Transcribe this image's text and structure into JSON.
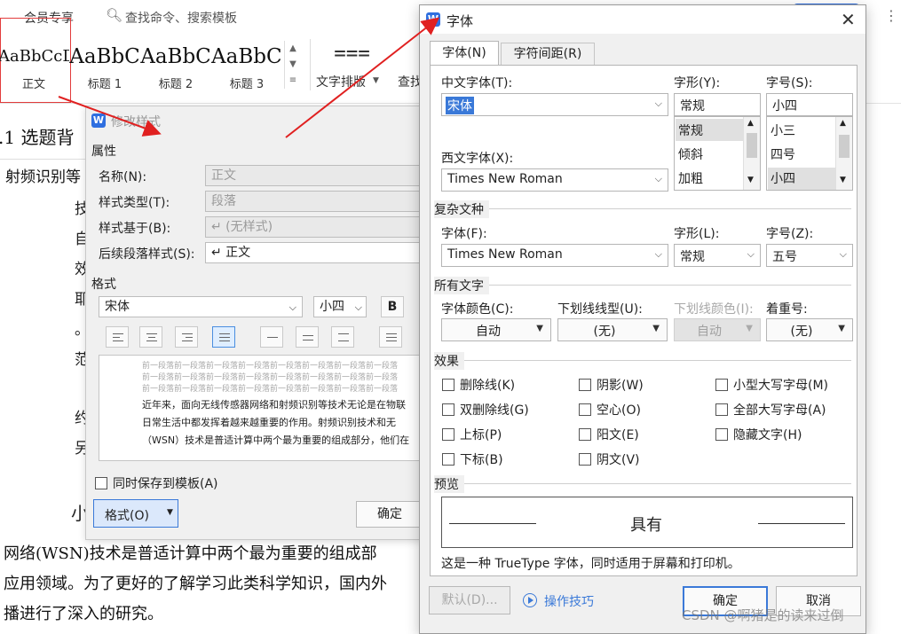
{
  "app": {
    "tabs": {
      "member": "会员专享",
      "search": "查找命令、搜索模板"
    },
    "styles": [
      {
        "preview": "AaBbCcDd",
        "label": "正文"
      },
      {
        "preview": "AaBbC",
        "label": "标题 1"
      },
      {
        "preview": "AaBbC",
        "label": "标题 2"
      },
      {
        "preview": "AaBbCc",
        "label": "标题 3"
      }
    ],
    "text_layout_label": "文字排版",
    "find_label": "查找",
    "doc": {
      "heading": ".1 选题背",
      "line2": "射频识别等",
      "body_lines": [
        "网络(WSN)技术是普适计算中两个最为重要的组成部",
        "应用领域。为了更好的了解学习此类科学知识，国内外",
        "播进行了深入的研究。"
      ],
      "side_chars": [
        "技",
        "自",
        "效",
        "耶",
        "。",
        "范",
        "约",
        "另",
        "小"
      ]
    }
  },
  "modify_dialog": {
    "title": "修改样式",
    "attributes_label": "属性",
    "name_label": "名称(N):",
    "name_value": "正文",
    "type_label": "样式类型(T):",
    "type_value": "段落",
    "based_label": "样式基于(B):",
    "based_value": "↵ (无样式)",
    "next_label": "后续段落样式(S):",
    "next_value": "↵ 正文",
    "format_label": "格式",
    "font_value": "宋体",
    "size_value": "小四",
    "bold": "B",
    "preview_prev": "前一段落前一段落前一段落前一段落前一段落前一段落前一段落前一段落",
    "preview_text": [
      "近年来，面向无线传感器网络和射频识别等技术无论是在物联",
      "日常生活中都发挥着越来越重要的作用。射频识别技术和无",
      "（WSN）技术是普适计算中两个最为重要的组成部分，他们在"
    ],
    "save_template_label": "同时保存到模板(A)",
    "format_button": "格式(O)",
    "ok_button": "确定"
  },
  "font_dialog": {
    "title": "字体",
    "tabs": [
      "字体(N)",
      "字符间距(R)"
    ],
    "cn_font_label": "中文字体(T):",
    "cn_font_value": "宋体",
    "style_label": "字形(Y):",
    "style_value": "常规",
    "size_label": "字号(S):",
    "size_value": "小四",
    "style_list": [
      "常规",
      "倾斜",
      "加粗"
    ],
    "size_list": [
      "小三",
      "四号",
      "小四"
    ],
    "west_font_label": "西文字体(X):",
    "west_font_value": "Times New Roman",
    "complex_section": "复杂文种",
    "complex_font_label": "字体(F):",
    "complex_font_value": "Times New Roman",
    "complex_style_label": "字形(L):",
    "complex_style_value": "常规",
    "complex_size_label": "字号(Z):",
    "complex_size_value": "五号",
    "all_text_section": "所有文字",
    "color_label": "字体颜色(C):",
    "color_value": "自动",
    "underline_label": "下划线线型(U):",
    "underline_value": "(无)",
    "underline_color_label": "下划线颜色(I):",
    "underline_color_value": "自动",
    "emphasis_label": "着重号:",
    "emphasis_value": "(无)",
    "effects_section": "效果",
    "effects": [
      [
        "删除线(K)",
        "阴影(W)",
        "小型大写字母(M)"
      ],
      [
        "双删除线(G)",
        "空心(O)",
        "全部大写字母(A)"
      ],
      [
        "上标(P)",
        "阳文(E)",
        "隐藏文字(H)"
      ],
      [
        "下标(B)",
        "阴文(V)",
        ""
      ]
    ],
    "preview_section": "预览",
    "preview_text": "具有",
    "truetype_note": "这是一种 TrueType 字体，同时适用于屏幕和打印机。",
    "default_button": "默认(D)...",
    "tips_label": "操作技巧",
    "ok_button": "确定",
    "cancel_button": "取消"
  },
  "watermark": "CSDN @啊猪是的读来过倒",
  "colors": {
    "accent": "#3a79d8",
    "arrow": "#e02020",
    "wps_blue": "#2f6fe0"
  }
}
